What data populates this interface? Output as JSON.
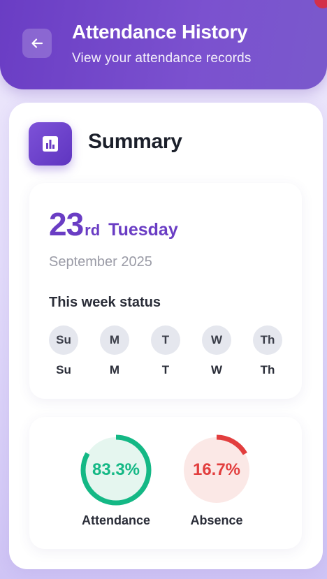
{
  "header": {
    "title": "Attendance History",
    "subtitle": "View your attendance records"
  },
  "summary": {
    "title": "Summary",
    "icon": "bar-chart-icon"
  },
  "date": {
    "day": "23",
    "suffix": "rd",
    "weekday": "Tuesday",
    "month_year": "September 2025"
  },
  "week": {
    "label": "This week status",
    "days": [
      {
        "circle": "Su",
        "label": "Su"
      },
      {
        "circle": "M",
        "label": "M"
      },
      {
        "circle": "T",
        "label": "T"
      },
      {
        "circle": "W",
        "label": "W"
      },
      {
        "circle": "Th",
        "label": "Th"
      }
    ]
  },
  "stats": {
    "attendance": {
      "value": "83.3%",
      "fraction": 0.833,
      "label": "Attendance"
    },
    "absence": {
      "value": "16.7%",
      "fraction": 0.167,
      "label": "Absence"
    }
  },
  "colors": {
    "brand": "#6a3dc4",
    "attendance": "#14b885",
    "attendance_bg": "#e5f6ef",
    "absence": "#e23e3e",
    "absence_bg": "#fbe8e6"
  }
}
